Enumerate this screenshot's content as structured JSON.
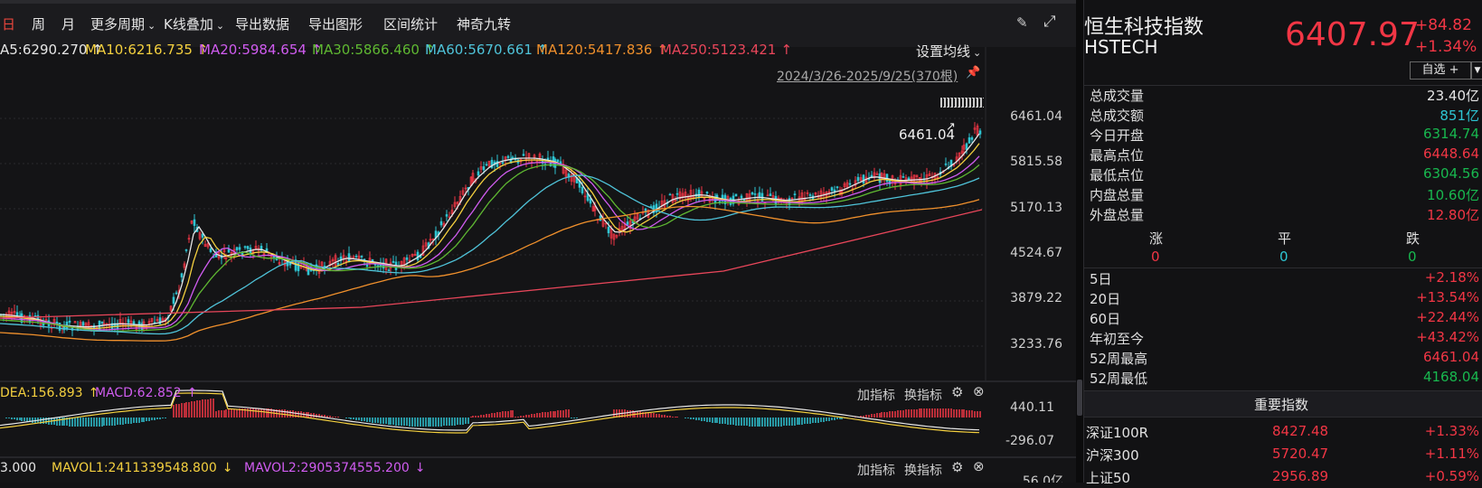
{
  "toolbar": {
    "items": [
      {
        "label": "日",
        "active": true
      },
      {
        "label": "周"
      },
      {
        "label": "月"
      },
      {
        "label": "更多周期"
      },
      {
        "label": "K线叠加"
      },
      {
        "label": "导出数据"
      },
      {
        "label": "导出图形"
      },
      {
        "label": "区间统计"
      },
      {
        "label": "神奇九转"
      }
    ],
    "icons": [
      "brush-icon",
      "fullscreen-icon"
    ]
  },
  "ma_legend": {
    "items": [
      {
        "text": "A5:6290.270",
        "arrow": "↑",
        "color": "#e6e6e6"
      },
      {
        "text": "MA10:6216.735",
        "arrow": "↑",
        "color": "#f4d03f"
      },
      {
        "text": "MA20:5984.654",
        "arrow": "↑",
        "color": "#d05cf0"
      },
      {
        "text": "MA30:5866.460",
        "arrow": "↑",
        "color": "#5fb832"
      },
      {
        "text": "MA60:5670.661",
        "arrow": "↑",
        "color": "#4fc3d9"
      },
      {
        "text": "MA120:5417.836",
        "arrow": "↑",
        "color": "#f0902c"
      },
      {
        "text": "MA250:5123.421",
        "arrow": "↑",
        "color": "#e8465a"
      }
    ],
    "settings": "设置均线"
  },
  "range_label": "2024/3/26-2025/9/25(370根)",
  "high_marker": "6461.04",
  "price_axis": [
    "6461.04",
    "5815.58",
    "5170.13",
    "4524.67",
    "3879.22",
    "3233.76"
  ],
  "macd_panel": {
    "legend": [
      {
        "text": "DEA:156.893",
        "arrow": "↑",
        "color": "#f4d03f"
      },
      {
        "text": "MACD:62.852",
        "arrow": "↑",
        "color": "#d05cf0"
      }
    ],
    "add": "加指标",
    "switch": "换指标",
    "axis": [
      "440.11",
      "-296.07"
    ]
  },
  "vol_panel": {
    "legend": [
      {
        "text": "3.000",
        "arrow": "",
        "color": "#e6e6e6"
      },
      {
        "text": "MAVOL1:2411339548.800",
        "arrow": "↓",
        "color": "#f4d03f"
      },
      {
        "text": "MAVOL2:2905374555.200",
        "arrow": "↓",
        "color": "#d05cf0"
      }
    ],
    "add": "加指标",
    "switch": "换指标",
    "axis_top": "56.0亿"
  },
  "quote": {
    "name": "恒生科技指数",
    "code": "HSTECH",
    "price": "6407.97",
    "change": "+84.82",
    "change_pct": "+1.34%",
    "watchlist": "自选 +",
    "stats": [
      {
        "label": "总成交量",
        "value": "23.40亿",
        "color": "#e6e6e6"
      },
      {
        "label": "总成交额",
        "value": "851亿",
        "color": "#2ec5d3"
      },
      {
        "label": "今日开盘",
        "value": "6314.74",
        "color": "#18b84f"
      },
      {
        "label": "最高点位",
        "value": "6448.64",
        "color": "#f23645"
      },
      {
        "label": "最低点位",
        "value": "6304.56",
        "color": "#18b84f"
      },
      {
        "label": "内盘总量",
        "value": "10.60亿",
        "color": "#18b84f"
      },
      {
        "label": "外盘总量",
        "value": "12.80亿",
        "color": "#f23645"
      }
    ],
    "breadth": {
      "labels": [
        "涨",
        "平",
        "跌"
      ],
      "values": [
        "0",
        "0",
        "0"
      ]
    },
    "periods": [
      {
        "label": "5日",
        "value": "+2.18%",
        "color": "#f23645"
      },
      {
        "label": "20日",
        "value": "+13.54%",
        "color": "#f23645"
      },
      {
        "label": "60日",
        "value": "+22.44%",
        "color": "#f23645"
      },
      {
        "label": "年初至今",
        "value": "+43.42%",
        "color": "#f23645"
      },
      {
        "label": "52周最高",
        "value": "6461.04",
        "color": "#f23645"
      },
      {
        "label": "52周最低",
        "value": "4168.04",
        "color": "#18b84f"
      }
    ]
  },
  "indices": {
    "title": "重要指数",
    "rows": [
      {
        "name": "深证100R",
        "price": "8427.48",
        "pct": "+1.33%"
      },
      {
        "name": "沪深300",
        "price": "5720.47",
        "pct": "+1.11%"
      },
      {
        "name": "上证50",
        "price": "2956.89",
        "pct": "+0.59%"
      }
    ]
  },
  "colors": {
    "up": "#f23645",
    "down": "#18b84f",
    "bg": "#141416"
  }
}
